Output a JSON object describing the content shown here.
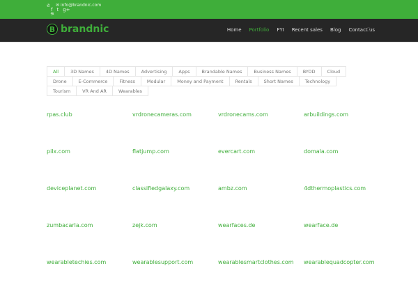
{
  "topbar": {
    "email": "info@brandnic.com",
    "icons": [
      "phone-icon",
      "email-icon",
      "facebook-icon",
      "twitter-icon",
      "google-plus-icon",
      "rss-icon"
    ]
  },
  "logo": {
    "letter": "B",
    "name": "brandnic"
  },
  "nav": [
    {
      "label": "Home"
    },
    {
      "label": "Portfolio",
      "active": true
    },
    {
      "label": "FYI"
    },
    {
      "label": "Recent sales"
    },
    {
      "label": "Blog"
    },
    {
      "label": "Contact us"
    }
  ],
  "filters": [
    "All",
    "3D Names",
    "4D Names",
    "Advertising",
    "Apps",
    "Brandable Names",
    "Business Names",
    "BYOD",
    "Cloud",
    "Drone",
    "E-Commerce",
    "Fitness",
    "Modular",
    "Money and Payment",
    "Rentals",
    "Short Names",
    "Technology",
    "Tourism",
    "VR And AR",
    "Wearables"
  ],
  "domains": [
    "rpas.club",
    "vrdronecameras.com",
    "vrdronecams.com",
    "arbuildings.com",
    "pilx.com",
    "flatjump.com",
    "evercart.com",
    "domala.com",
    "deviceplanet.com",
    "classifiedgalaxy.com",
    "ambz.com",
    "4dthermoplastics.com",
    "zumbacarla.com",
    "zejk.com",
    "wearfaces.de",
    "wearface.de",
    "wearabletechies.com",
    "wearablesupport.com",
    "wearablesmartclothes.com",
    "wearablequadcopter.com"
  ],
  "colors": {
    "accent": "#3fae3a",
    "header": "#262626"
  }
}
